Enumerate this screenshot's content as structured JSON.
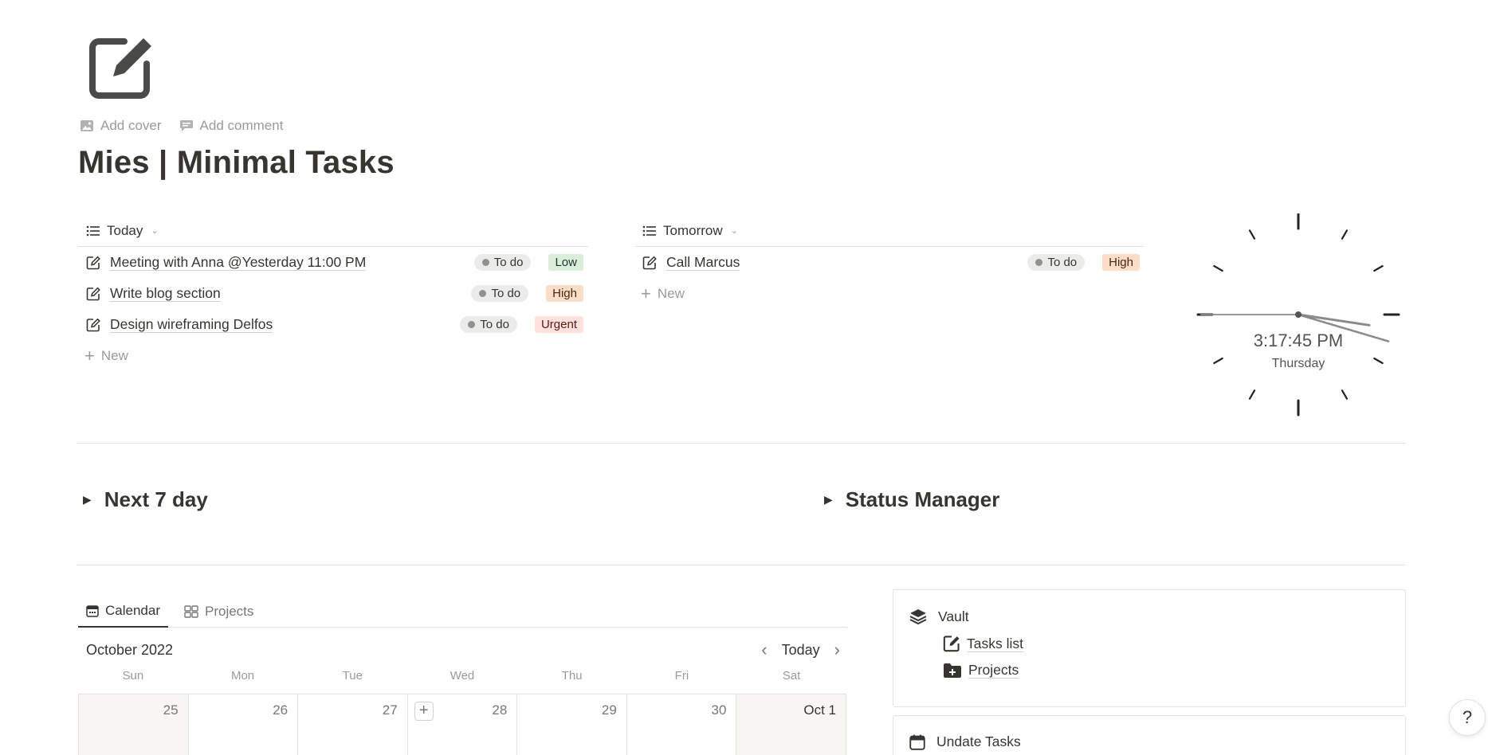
{
  "page": {
    "icon": "edit-square-icon",
    "actions": [
      {
        "label": "Add cover",
        "icon": "image-icon"
      },
      {
        "label": "Add comment",
        "icon": "comment-icon"
      }
    ],
    "title": "Mies | Minimal Tasks"
  },
  "today": {
    "view_label": "Today",
    "tasks": [
      {
        "title": "Meeting with Anna @Yesterday 11:00 PM",
        "status": "To do",
        "priority": "Low"
      },
      {
        "title": "Write blog section",
        "status": "To do",
        "priority": "High"
      },
      {
        "title": "Design wireframing Delfos",
        "status": "To do",
        "priority": "Urgent"
      }
    ],
    "new_label": "New"
  },
  "tomorrow": {
    "view_label": "Tomorrow",
    "tasks": [
      {
        "title": "Call Marcus",
        "status": "To do",
        "priority": "High"
      }
    ],
    "new_label": "New"
  },
  "clock": {
    "time": "3:17:45 PM",
    "day": "Thursday",
    "hours": 3,
    "minutes": 17,
    "seconds": 45
  },
  "toggles": {
    "next7": "Next 7 day",
    "status_manager": "Status Manager"
  },
  "calendar": {
    "tabs": [
      {
        "label": "Calendar",
        "icon": "calendar-icon",
        "active": true
      },
      {
        "label": "Projects",
        "icon": "gallery-icon",
        "active": false
      }
    ],
    "month": "October 2022",
    "today_label": "Today",
    "weekdays": [
      "Sun",
      "Mon",
      "Tue",
      "Wed",
      "Thu",
      "Fri",
      "Sat"
    ],
    "days": [
      "25",
      "26",
      "27",
      "28",
      "29",
      "30",
      "Oct 1"
    ]
  },
  "vault": {
    "title": "Vault",
    "links": [
      {
        "label": "Tasks list",
        "icon": "edit-square-icon"
      },
      {
        "label": "Projects",
        "icon": "folder-plus-icon"
      }
    ]
  },
  "update": {
    "title": "Undate Tasks"
  },
  "help_label": "?",
  "colors": {
    "text": "#37352f",
    "muted": "#9b9a97",
    "low_bg": "#dbeddb",
    "high_bg": "#fadec9",
    "urgent_bg": "#ffe2dd",
    "status_bg": "#ebebea"
  }
}
